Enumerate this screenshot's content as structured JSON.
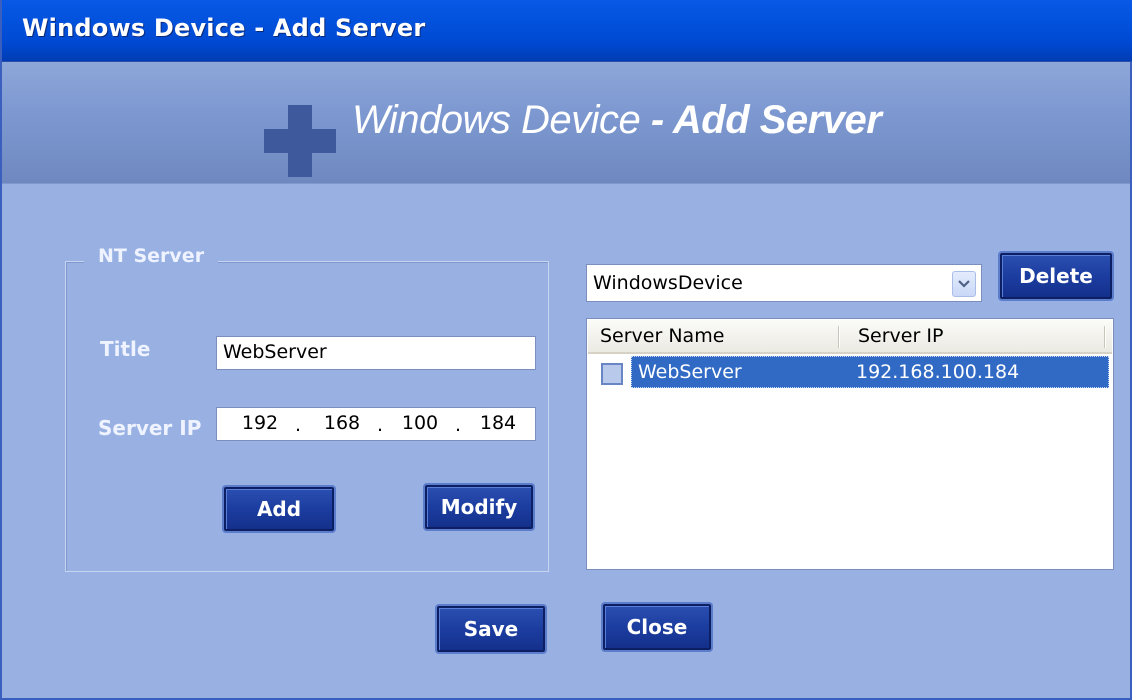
{
  "window": {
    "title": "Windows Device - Add Server"
  },
  "banner": {
    "title_light": "Windows Device",
    "title_bold": "- Add Server"
  },
  "group": {
    "legend": "NT Server",
    "title_label": "Title",
    "title_value": "WebServer",
    "ip_label": "Server IP",
    "ip": [
      "192",
      "168",
      "100",
      "184"
    ],
    "ip_separator": ".",
    "add_label": "Add",
    "modify_label": "Modify"
  },
  "right": {
    "combo_value": "WindowsDevice",
    "delete_label": "Delete",
    "columns": [
      "Server Name",
      "Server IP"
    ],
    "rows": [
      {
        "name": "WebServer",
        "ip": "192.168.100.184",
        "selected": true,
        "checked": false
      }
    ]
  },
  "footer": {
    "save_label": "Save",
    "close_label": "Close"
  },
  "colors": {
    "titlebar": "#0353de",
    "dialog_bg": "#98b1e2",
    "button": "#1c3da0",
    "selection": "#316ac5",
    "cross_icon": "#3f5a9c"
  },
  "icons": {
    "banner": "cross-icon",
    "combo_dropdown": "chevron-down-icon"
  }
}
